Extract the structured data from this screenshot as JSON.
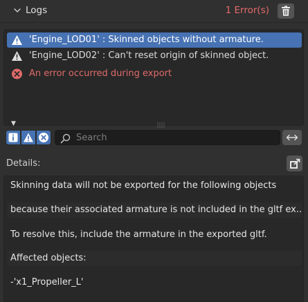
{
  "header": {
    "title": "Logs",
    "error_count": "1 Error(s)",
    "chevron_icon": "chevron-down-icon",
    "trash_icon": "trash-icon"
  },
  "log_entries": [
    {
      "level": "warning",
      "icon": "warning-icon",
      "text": "'Engine_LOD01' : Skinned objects without armature.",
      "selected": true
    },
    {
      "level": "warning",
      "icon": "warning-icon",
      "text": "'Engine_LOD02' : Can't reset origin of skinned object.",
      "selected": false
    },
    {
      "level": "error",
      "icon": "error-icon",
      "text": "An error occurred during export",
      "selected": false
    }
  ],
  "filters": {
    "info_icon": "info-filter-icon",
    "warning_icon": "warning-filter-icon",
    "error_icon": "error-filter-icon"
  },
  "search": {
    "placeholder": "Search",
    "value": ""
  },
  "details": {
    "label": "Details:",
    "lines": [
      "Skinning data will not be exported for the following objects",
      "because their associated armature is not included in the gltf ex...",
      "To resolve this, include the armature in the exported gltf.",
      "Affected objects:",
      "-'x1_Propeller_L'"
    ]
  },
  "colors": {
    "accent": "#4772b3",
    "error": "#e06a6a",
    "background": "#303030"
  }
}
